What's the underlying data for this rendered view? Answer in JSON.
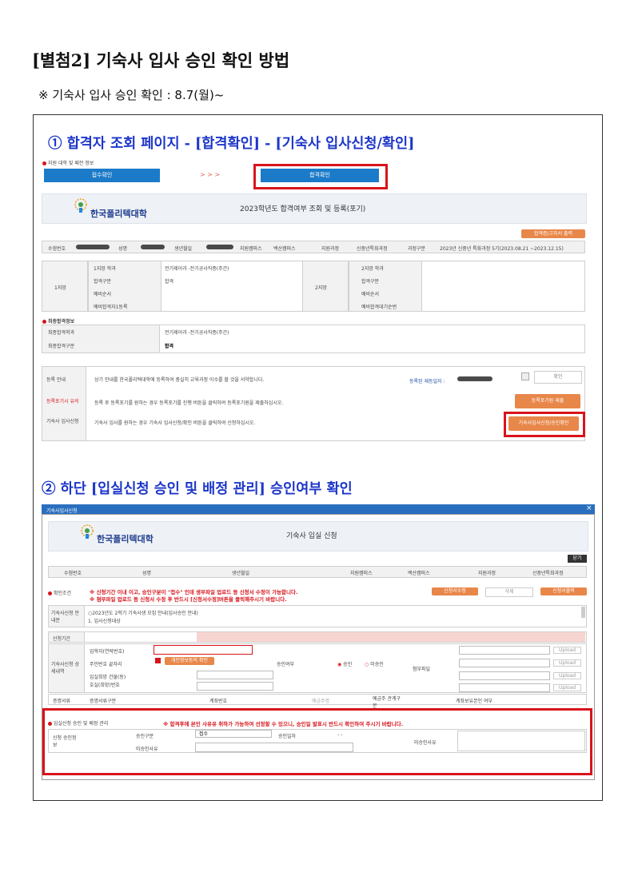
{
  "heading": "[별첨2] 기숙사 입사 승인 확인 방법",
  "subheading": "※ 기숙사 입사 승인 확인 : 8.7(월)~",
  "step1": {
    "title": "① 합격자 조회 페이지 - [합격확인] - [기숙사 입사신청/확인]",
    "section_label": "지원 대학 및 패전 정보",
    "btn_receipt": "접수확인",
    "arrows": "> > >",
    "btn_pass": "합격확인",
    "logo": "한국폴리텍대학",
    "banner_title": "2023학년도 합격여부 조회 및 등록(포기)",
    "print_btn": "합격증/고지서 출력",
    "info_row": [
      "수험번호",
      "성명",
      "생년월일",
      "지원캠퍼스",
      "백산캠퍼스",
      "지원과정",
      "신중년특화과정",
      "과정구분",
      "2023년 신중년 특화과정 5기(2023.08.21 ~2023.12.15)"
    ],
    "choice1_label": "1지망",
    "choice2_label": "2지망",
    "choice_rows": [
      {
        "k": "1지망 학과",
        "v": "전기제어과 -전기공사직종(주간)"
      },
      {
        "k": "합격구분",
        "v": "합격"
      },
      {
        "k": "예비순서",
        "v": ""
      },
      {
        "k": "예비합격자1등록",
        "v": ""
      }
    ],
    "choice2_rows": [
      "2지망 학과",
      "합격구분",
      "예비순서",
      "예비합격대기순번"
    ],
    "final_label": "최종합격정보",
    "final_rows": [
      {
        "k": "최종합격학과",
        "v": "전기제어과 -전기공사직종(주간)"
      },
      {
        "k": "최종합격구분",
        "v": "합격"
      }
    ],
    "reg_label": "등록 안내",
    "reg_text": "상기 안내를 한국폴리텍대학에 등록하여 충실히 교육과정 이수를 할 것을 서약합니다.",
    "reg_date_label": "등록된 재등일자 :",
    "confirm_btn": "확인",
    "cancel_label": "등록포기시 유의",
    "cancel_text": "등록 후 등록포기를 원하는 경우 등록포기를 진행 버튼을 클릭하여 등록포기원을 제출하십시오.",
    "cancel_btn": "등록포기원 제출",
    "dorm_label": "기숙사 입사신청",
    "dorm_text": "기숙사 입사를 원하는 경우 기숙사 입사신청/확인 버튼을 클릭하여 신청하십시오.",
    "dorm_btn": "기숙사입사신청/승인확인"
  },
  "step2": {
    "title": "② 하단 [입실신청 승인 및 배정 관리] 승인여부 확인",
    "window_title": "기숙사입사신청",
    "close": "×",
    "logo": "한국폴리텍대학",
    "banner_title": "기숙사 입실 신청",
    "tag": "닫기",
    "info_row": [
      "수험번호",
      "성명",
      "생년월일",
      "지원캠퍼스",
      "백산캠퍼스",
      "지원과정",
      "신중년특화과정"
    ],
    "notice_label": "확인조건",
    "notice_lines": [
      "※ 신청기간 이내 이고, 승인구분이 \"접수\" 인데 생부파일 업로드 등 신청서 수정이 가능합니다.",
      "※ 첨부파일 업로드 등 신청서 수정 후 반드시 [신청서수정]버튼을 클릭해주시기 바랍니다."
    ],
    "btn_edit": "신청서수정",
    "btn_delete": "삭제",
    "btn_print": "신청서출력",
    "guide_label": "기숙사신청 안내문",
    "guide_lines": [
      "○2023년도 2학기 기숙사생 모집 안내(입사승인 안내)",
      "1. 입사신청대상"
    ],
    "detail_label": "기숙사신청 상세내역",
    "row_labels": [
      "신청기간",
      "입학자(연락번호)",
      "주민번호 끝자리",
      "입실희망 건물(동)",
      "호실(희망)번호"
    ],
    "agree_label": "개인정보동의 확인",
    "approval_label": "승인여부",
    "radio_yes": "승인",
    "radio_no": "미승인",
    "attach_label": "첨부파일",
    "upload_label": "Upload",
    "bottom_row": [
      "증명서류",
      "증명서류구분",
      "계좌번호",
      "예금주명",
      "예금주 관계구분",
      "계좌보유본인 여부"
    ],
    "mgmt_label": "입실신청 승인 및 배정 관리",
    "mgmt_notice": "※ 합격후에 본인 사유유 취하가 가능하여 선정할 수 있으니, 승인일 발표시 반드시 확인하여 주시기 바랍니다.",
    "mgmt_rows": {
      "left_label": "신청 승인정보",
      "approval_type_label": "승인구분",
      "approval_type_value": "접수",
      "approval_date_label": "승인일자",
      "approval_date_value": "- -",
      "reject_reason_label": "미승인사유",
      "remark_label": "미승인사유"
    }
  },
  "colors": {
    "title_blue": "#1d36c9",
    "highlight_red": "#d8141c",
    "btn_blue": "#1c7bc9",
    "btn_orange": "#e8874a"
  }
}
